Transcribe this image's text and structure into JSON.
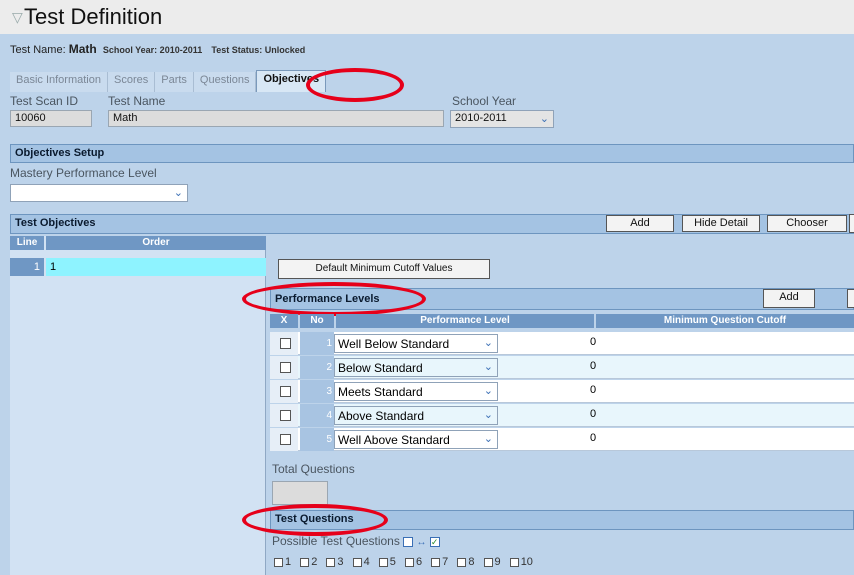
{
  "title": "Test Definition",
  "test_info": {
    "name_label": "Test Name:",
    "name_value": "Math",
    "school_year": "School Year: 2010-2011",
    "status": "Test Status: Unlocked"
  },
  "tabs": [
    {
      "label": "Basic Information"
    },
    {
      "label": "Scores"
    },
    {
      "label": "Parts"
    },
    {
      "label": "Questions"
    },
    {
      "label": "Objectives"
    }
  ],
  "fields": {
    "scan_id_label": "Test Scan ID",
    "scan_id_value": "10060",
    "test_name_label": "Test Name",
    "test_name_value": "Math",
    "school_year_label": "School Year",
    "school_year_value": "2010-2011"
  },
  "objectives_setup": {
    "title": "Objectives Setup",
    "mastery_label": "Mastery Performance Level",
    "mastery_value": ""
  },
  "test_objectives": {
    "title": "Test Objectives",
    "add": "Add",
    "hide_detail": "Hide Detail",
    "chooser": "Chooser",
    "col_line": "Line",
    "col_order": "Order",
    "row_line": "1",
    "row_order": "1"
  },
  "default_cutoff_button": "Default Minimum Cutoff Values",
  "performance_levels": {
    "title": "Performance Levels",
    "add": "Add",
    "col_x": "X",
    "col_num": "No",
    "col_level": "Performance Level",
    "col_cutoff": "Minimum Question Cutoff",
    "rows": [
      {
        "num": "1",
        "level": "Well Below Standard",
        "cutoff": "0"
      },
      {
        "num": "2",
        "level": "Below Standard",
        "cutoff": "0"
      },
      {
        "num": "3",
        "level": "Meets Standard",
        "cutoff": "0"
      },
      {
        "num": "4",
        "level": "Above Standard",
        "cutoff": "0"
      },
      {
        "num": "5",
        "level": "Well Above Standard",
        "cutoff": "0"
      }
    ]
  },
  "total_questions": {
    "label": "Total Questions",
    "value": ""
  },
  "test_questions": {
    "title": "Test Questions",
    "possible_label": "Possible Test Questions",
    "questions": [
      "1",
      "2",
      "3",
      "4",
      "5",
      "6",
      "7",
      "8",
      "9",
      "10"
    ]
  },
  "colors": {
    "background": "#bdd3ea",
    "header_blue": "#a4c3e3",
    "grid_head": "#6f97c4",
    "highlight": "#e6001a",
    "selected_row": "#8ef3ff"
  }
}
